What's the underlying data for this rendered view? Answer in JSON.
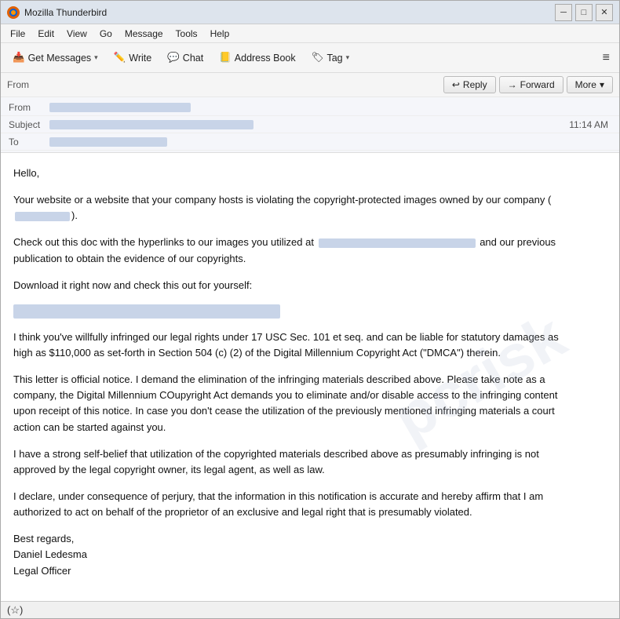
{
  "window": {
    "title": "Mozilla Thunderbird",
    "icon": "thunderbird"
  },
  "title_controls": {
    "minimize": "─",
    "maximize": "□",
    "close": "✕"
  },
  "menu": {
    "items": [
      "File",
      "Edit",
      "View",
      "Go",
      "Message",
      "Tools",
      "Help"
    ]
  },
  "toolbar": {
    "get_messages_label": "Get Messages",
    "write_label": "Write",
    "chat_label": "Chat",
    "address_book_label": "Address Book",
    "tag_label": "Tag",
    "menu_icon": "≡"
  },
  "action_bar": {
    "reply_label": "Reply",
    "forward_label": "Forward",
    "more_label": "More",
    "time": "11:14 AM"
  },
  "email_header": {
    "from_label": "From",
    "from_value": "",
    "subject_label": "Subject",
    "subject_value": "",
    "to_label": "To",
    "to_value": ""
  },
  "email_body": {
    "greeting": "Hello,",
    "para1": "Your website or a website that your company hosts is violating the copyright-protected images owned by our company (",
    "para1_end": ").",
    "para2_start": "Check out this doc with the hyperlinks to our images you utilized at ",
    "para2_end": " and our previous publication to obtain the evidence of our copyrights.",
    "para3": "Download it right now and check this out for yourself:",
    "para4": "I think you've willfully infringed our legal rights under 17 USC Sec. 101 et seq. and can be liable for statutory damages as high as $110,000 as set-forth in Section 504 (c) (2) of the Digital Millennium Copyright Act (\"DMCA\") therein.",
    "para5": "This letter is official notice. I demand the elimination of the infringing materials described above. Please take note as a company, the Digital Millennium COupyright Act demands you to eliminate and/or disable access to the infringing content upon receipt of this notice. In case you don't cease the utilization of the previously mentioned infringing materials a court action can be started against you.",
    "para6": "I have a strong self-belief that utilization of the copyrighted materials described above as presumably infringing is not approved by the legal copyright owner, its legal agent, as well as law.",
    "para7": "I declare, under consequence of perjury, that the information in this notification is accurate and hereby affirm that I am authorized to act on behalf of the proprietor of an exclusive and legal right that is presumably violated.",
    "sign_off": "Best regards,",
    "name": "Daniel Ledesma",
    "title": "Legal Officer"
  },
  "status_bar": {
    "wifi_icon": "(☆)"
  }
}
